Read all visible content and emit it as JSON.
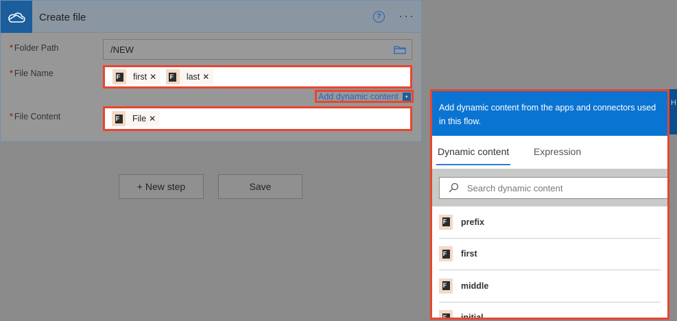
{
  "card": {
    "title": "Create file",
    "help_icon": "question-icon",
    "more_icon": "ellipsis-icon",
    "folder_path": {
      "label": "Folder Path",
      "value": "/NEW"
    },
    "file_name": {
      "label": "File Name",
      "tokens": [
        "first",
        "last"
      ]
    },
    "file_content": {
      "label": "File Content",
      "tokens": [
        "File"
      ]
    },
    "add_dynamic": "Add dynamic content",
    "required": "*"
  },
  "actions": {
    "new_step": "+ New step",
    "save": "Save"
  },
  "panel": {
    "header": "Add dynamic content from the apps and connectors used in this flow.",
    "tabs": [
      "Dynamic content",
      "Expression"
    ],
    "search_placeholder": "Search dynamic content",
    "items": [
      "prefix",
      "first",
      "middle",
      "initial"
    ],
    "side_letter": "H"
  },
  "colors": {
    "accent": "#0a74d2",
    "highlight": "#e8452f"
  }
}
